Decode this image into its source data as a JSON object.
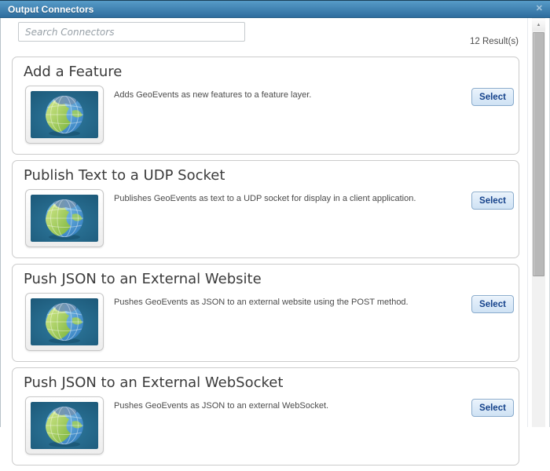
{
  "dialog": {
    "title": "Output Connectors",
    "close_glyph": "✕"
  },
  "search": {
    "placeholder": "Search Connectors"
  },
  "results": {
    "count_label": "12 Result(s)"
  },
  "select_button_label": "Select",
  "connectors": [
    {
      "title": "Add a Feature",
      "description": "Adds GeoEvents as new features to a feature layer.",
      "icon": "globe-icon"
    },
    {
      "title": "Publish Text to a UDP Socket",
      "description": "Publishes GeoEvents as text to a UDP socket for display in a client application.",
      "icon": "globe-icon"
    },
    {
      "title": "Push JSON to an External Website",
      "description": "Pushes GeoEvents as JSON to an external website using the POST method.",
      "icon": "globe-icon"
    },
    {
      "title": "Push JSON to an External WebSocket",
      "description": "Pushes GeoEvents as JSON to an external WebSocket.",
      "icon": "globe-icon"
    }
  ],
  "scrollbar": {
    "up_arrow": "▲"
  },
  "colors": {
    "titlebar_top": "#579bc8",
    "titlebar_bottom": "#2e6d9e",
    "card_border": "#cbcbcb",
    "button_border": "#89abcc",
    "button_text": "#15428b",
    "thumb_background": "#1d5a7c"
  }
}
